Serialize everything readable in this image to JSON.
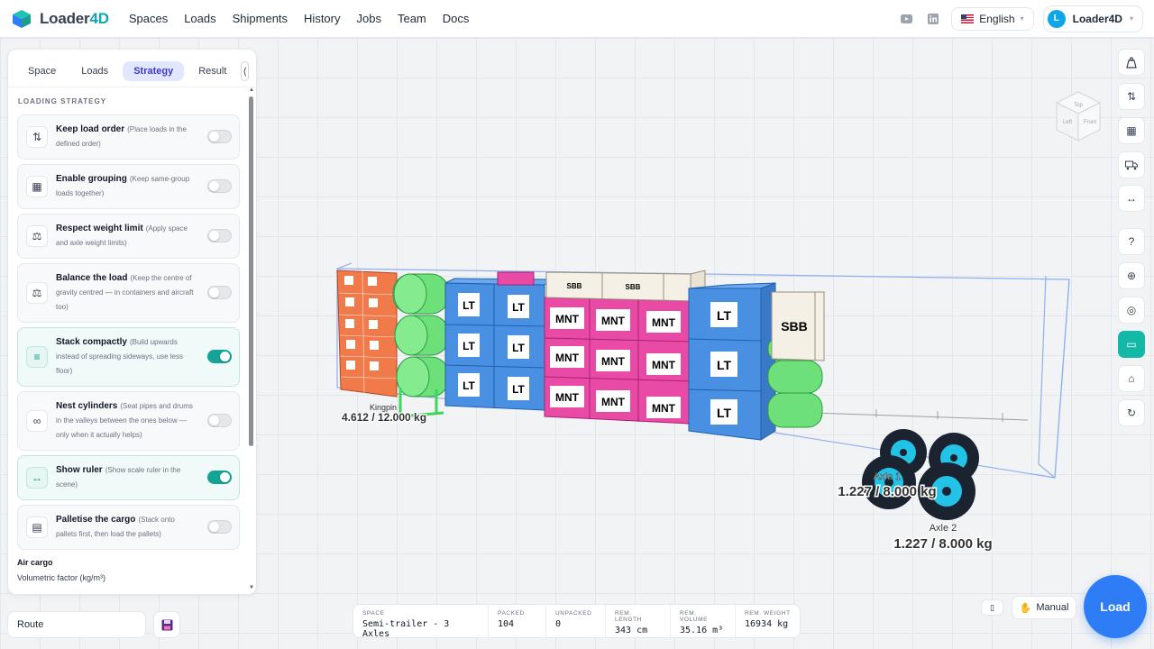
{
  "app": {
    "brand_prefix": "Loader",
    "brand_suffix": "4D"
  },
  "nav": [
    "Spaces",
    "Loads",
    "Shipments",
    "History",
    "Jobs",
    "Team",
    "Docs"
  ],
  "header": {
    "language": "English",
    "user_initial": "L",
    "user_name": "Loader4D"
  },
  "tabs": [
    {
      "label": "Space",
      "active": false
    },
    {
      "label": "Loads",
      "active": false
    },
    {
      "label": "Strategy",
      "active": true
    },
    {
      "label": "Result",
      "active": false
    }
  ],
  "strategy": {
    "section_title": "LOADING STRATEGY",
    "options": [
      {
        "title": "Keep load order",
        "desc": "(Place loads in the defined order)",
        "on": false,
        "icon": "sort-order-icon"
      },
      {
        "title": "Enable grouping",
        "desc": "(Keep same-group loads together)",
        "on": false,
        "icon": "grouping-icon"
      },
      {
        "title": "Respect weight limit",
        "desc": "(Apply space and axle weight limits)",
        "on": false,
        "icon": "weight-icon"
      },
      {
        "title": "Balance the load",
        "desc": "(Keep the centre of gravity centred — in containers and aircraft too)",
        "on": false,
        "icon": "balance-scale-icon"
      },
      {
        "title": "Stack compactly",
        "desc": "(Build upwards instead of spreading sideways, use less floor)",
        "on": true,
        "icon": "stack-icon"
      },
      {
        "title": "Nest cylinders",
        "desc": "(Seat pipes and drums in the valleys between the ones below — only when it actually helps)",
        "on": false,
        "icon": "cylinders-icon"
      },
      {
        "title": "Show ruler",
        "desc": "(Show scale ruler in the scene)",
        "on": true,
        "icon": "ruler-icon"
      },
      {
        "title": "Palletise the cargo",
        "desc": "(Stack onto pallets first, then load the pallets)",
        "on": false,
        "icon": "pallet-icon"
      }
    ],
    "air_cargo_title": "Air cargo",
    "volumetric_label": "Volumetric factor (kg/m³)"
  },
  "route_label": "Route",
  "stats": [
    {
      "label": "SPACE",
      "value": "Semi-trailer - 3 Axles"
    },
    {
      "label": "PACKED",
      "value": "104"
    },
    {
      "label": "UNPACKED",
      "value": "0"
    },
    {
      "label": "REM. LENGTH",
      "value": "343 cm"
    },
    {
      "label": "REM. VOLUME",
      "value": "35.16 m³"
    },
    {
      "label": "REM. WEIGHT",
      "value": "16934 kg"
    }
  ],
  "scene": {
    "kingpin_label": "Kingpin",
    "kingpin_value": "4.612 / 12.000 kg",
    "axle1_label": "Axle 1",
    "axle1_value": "1.227 / 8.000 kg",
    "axle2_label": "Axle 2",
    "axle2_value": "1.227 / 8.000 kg",
    "view_cube": {
      "top": "Top",
      "left": "Left",
      "front": "Front"
    },
    "box_labels": {
      "lt": "LT",
      "mnt": "MNT",
      "sbb": "SBB"
    },
    "colors": {
      "lt": "#4a90e2",
      "mnt": "#e94aa6",
      "sbb": "#f5f0e6",
      "cyl": "#6ee07a",
      "orange": "#f07a4a"
    }
  },
  "buttons": {
    "manual": "Manual",
    "load": "Load"
  }
}
